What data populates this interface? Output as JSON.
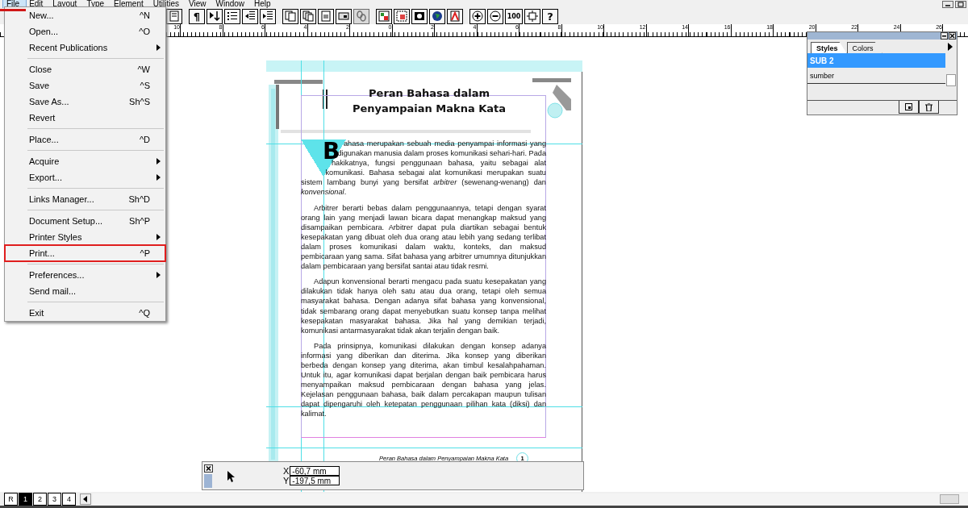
{
  "menubar": [
    {
      "label": "File",
      "selected": true
    },
    {
      "label": "Edit",
      "selected": false
    },
    {
      "label": "Layout",
      "selected": false
    },
    {
      "label": "Type",
      "selected": false
    },
    {
      "label": "Element",
      "selected": false
    },
    {
      "label": "Utilities",
      "selected": false
    },
    {
      "label": "View",
      "selected": false
    },
    {
      "label": "Window",
      "selected": false
    },
    {
      "label": "Help",
      "selected": false
    }
  ],
  "file_menu": [
    [
      {
        "label": "New...",
        "shortcut": "^N",
        "submenu": false,
        "highlighted": false
      },
      {
        "label": "Open...",
        "shortcut": "^O",
        "submenu": false,
        "highlighted": false
      },
      {
        "label": "Recent Publications",
        "submenu": true,
        "highlighted": false
      }
    ],
    [
      {
        "label": "Close",
        "shortcut": "^W",
        "submenu": false,
        "highlighted": false
      },
      {
        "label": "Save",
        "shortcut": "^S",
        "submenu": false,
        "highlighted": false
      },
      {
        "label": "Save As...",
        "shortcut": "Sh^S",
        "submenu": false,
        "highlighted": false
      },
      {
        "label": "Revert",
        "submenu": false,
        "highlighted": false
      }
    ],
    [
      {
        "label": "Place...",
        "shortcut": "^D",
        "submenu": false,
        "highlighted": false
      }
    ],
    [
      {
        "label": "Acquire",
        "submenu": true,
        "highlighted": false
      },
      {
        "label": "Export...",
        "submenu": true,
        "highlighted": false
      }
    ],
    [
      {
        "label": "Links Manager...",
        "shortcut": "Sh^D",
        "submenu": false,
        "highlighted": false
      }
    ],
    [
      {
        "label": "Document Setup...",
        "shortcut": "Sh^P",
        "submenu": false,
        "highlighted": false
      },
      {
        "label": "Printer Styles",
        "submenu": true,
        "highlighted": false
      },
      {
        "label": "Print...",
        "shortcut": "^P",
        "submenu": false,
        "highlighted": true
      }
    ],
    [
      {
        "label": "Preferences...",
        "submenu": true,
        "highlighted": false
      },
      {
        "label": "Send mail...",
        "submenu": false,
        "highlighted": false
      }
    ],
    [
      {
        "label": "Exit",
        "shortcut": "^Q",
        "submenu": false,
        "highlighted": false
      }
    ]
  ],
  "toolbar": [
    [
      {
        "kind": "icon",
        "disabled": false
      }
    ],
    [
      {
        "kind": "glyph",
        "label": "¶",
        "disabled": false
      },
      {
        "kind": "icon",
        "disabled": false
      },
      {
        "kind": "icon",
        "disabled": false
      },
      {
        "kind": "icon",
        "disabled": false
      },
      {
        "kind": "icon",
        "disabled": false
      }
    ],
    [
      {
        "kind": "icon",
        "disabled": false
      },
      {
        "kind": "icon",
        "disabled": false
      },
      {
        "kind": "icon",
        "disabled": false
      },
      {
        "kind": "icon",
        "disabled": false
      },
      {
        "kind": "icon",
        "disabled": true
      }
    ],
    [
      {
        "kind": "icon",
        "disabled": false
      },
      {
        "kind": "icon",
        "disabled": false
      },
      {
        "kind": "icon",
        "disabled": false
      },
      {
        "kind": "icon",
        "disabled": false
      },
      {
        "kind": "icon",
        "disabled": false
      }
    ],
    [
      {
        "kind": "icon",
        "disabled": false
      },
      {
        "kind": "icon",
        "disabled": false
      },
      {
        "kind": "glyph",
        "label": "100",
        "disabled": false
      },
      {
        "kind": "icon",
        "disabled": false
      },
      {
        "kind": "glyph",
        "label": "?",
        "disabled": false
      }
    ]
  ],
  "ruler": [
    "10",
    "8",
    "6",
    "4",
    "2",
    "0",
    "2",
    "4",
    "6",
    "8",
    "10",
    "12",
    "14",
    "16",
    "18",
    "20",
    "22",
    "24",
    "26"
  ],
  "document": {
    "title_lines": [
      "Peran Bahasa dalam",
      "Penyampaian Makna Kata"
    ],
    "drop_cap": true,
    "paragraphs": [
      "Bahasa merupakan sebuah media penyampai informasi yang digunakan manusia dalam proses komunikasi sehari-hari. Pada hakikatnya, fungsi penggunaan bahasa, yaitu sebagai alat komunikasi. Bahasa sebagai alat komunikasi merupakan suatu sistem lambang bunyi yang bersifat *arbitrer* (sewenang-wenang) dan *konvensional*.",
      "Arbitrer berarti bebas dalam penggunaannya, tetapi dengan syarat orang lain yang menjadi lawan bicara dapat menangkap maksud yang disampaikan pembicara. Arbitrer dapat pula diartikan sebagai bentuk kesepakatan yang dibuat oleh dua orang atau lebih yang sedang terlibat dalam proses komunikasi dalam waktu, konteks, dan maksud pembicaraan yang sama. Sifat bahasa yang arbitrer umumnya ditunjukkan dalam pembicaraan yang bersifat santai atau tidak resmi.",
      "Adapun konvensional berarti mengacu pada suatu kesepakatan yang dilakukan tidak hanya oleh satu atau dua orang, tetapi oleh semua masyarakat bahasa. Dengan adanya sifat bahasa yang konvensional, tidak sembarang orang dapat menyebutkan suatu konsep tanpa melihat kesepakatan masyarakat bahasa. Jika hal yang demikian terjadi, komunikasi antarmasyarakat tidak akan terjalin dengan baik.",
      "Pada prinsipnya, komunikasi dilakukan dengan konsep adanya informasi yang diberikan dan diterima. Jika konsep yang diberikan berbeda dengan konsep yang diterima, akan timbul kesalahpahaman. Untuk itu, agar komunikasi dapat berjalan dengan baik pembicara harus menyampaikan maksud pembicaraan dengan bahasa yang jelas. Kejelasan penggunaan bahasa, baik dalam percakapan maupun tulisan dapat dipengaruhi oleh ketepatan penggunaan pilihan kata (diksi) dan kalimat."
    ],
    "footer": "Peran Bahasa dalam Penyampaian Makna Kata",
    "page_number": "1"
  },
  "styles_panel": {
    "tabs": [
      {
        "label": "Styles",
        "selected": true
      },
      {
        "label": "Colors",
        "selected": false
      }
    ],
    "styles": [
      {
        "label": "SUB 2",
        "selected": true
      },
      {
        "label": "sumber",
        "selected": false
      }
    ]
  },
  "coordinates": {
    "x_label": "X",
    "x_value": "-60,7 mm",
    "y_label": "Y",
    "y_value": "-197,5 mm"
  },
  "page_tabs": [
    {
      "label": "R",
      "selected": false
    },
    {
      "label": "1",
      "selected": true
    },
    {
      "label": "2",
      "selected": false
    },
    {
      "label": "3",
      "selected": false
    },
    {
      "label": "4",
      "selected": false
    }
  ]
}
